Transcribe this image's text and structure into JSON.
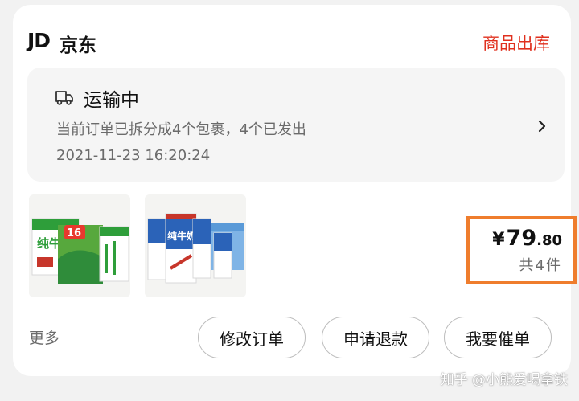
{
  "header": {
    "logo": "JD",
    "shop_name": "京东",
    "order_status": "商品出库"
  },
  "shipping": {
    "icon": "truck-icon",
    "title": "运输中",
    "detail": "当前订单已拆分成4个包裹，4个已发出",
    "time": "2021-11-23 16:20:24"
  },
  "products": [
    {
      "name": "纯牛奶",
      "badge": "16",
      "brand_color": "#2e9e3a"
    },
    {
      "name": "纯牛奶",
      "brand_color": "#2b63b8"
    }
  ],
  "summary": {
    "currency": "¥",
    "price_int": "79",
    "price_dec": ".80",
    "quantity": "共4件"
  },
  "footer": {
    "more": "更多",
    "modify_order": "修改订单",
    "request_refund": "申请退款",
    "urge_order": "我要催单"
  },
  "watermark": "知乎 @小熊爱喝拿铁",
  "colors": {
    "accent_red": "#e0301e",
    "highlight_orange": "#ef7d2d"
  }
}
